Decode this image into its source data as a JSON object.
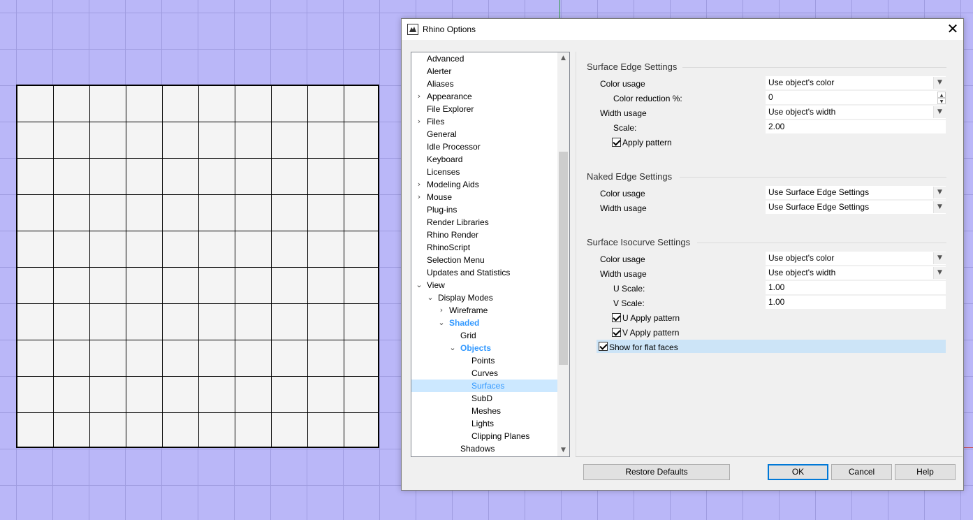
{
  "dialog": {
    "title": "Rhino Options",
    "close_glyph": "✕"
  },
  "tree": {
    "items": [
      {
        "label": "Advanced",
        "level": 0,
        "exp": ""
      },
      {
        "label": "Alerter",
        "level": 0,
        "exp": ""
      },
      {
        "label": "Aliases",
        "level": 0,
        "exp": ""
      },
      {
        "label": "Appearance",
        "level": 0,
        "exp": ">"
      },
      {
        "label": "File Explorer",
        "level": 0,
        "exp": ""
      },
      {
        "label": "Files",
        "level": 0,
        "exp": ">"
      },
      {
        "label": "General",
        "level": 0,
        "exp": ""
      },
      {
        "label": "Idle Processor",
        "level": 0,
        "exp": ""
      },
      {
        "label": "Keyboard",
        "level": 0,
        "exp": ""
      },
      {
        "label": "Licenses",
        "level": 0,
        "exp": ""
      },
      {
        "label": "Modeling Aids",
        "level": 0,
        "exp": ">"
      },
      {
        "label": "Mouse",
        "level": 0,
        "exp": ">"
      },
      {
        "label": "Plug-ins",
        "level": 0,
        "exp": ""
      },
      {
        "label": "Render Libraries",
        "level": 0,
        "exp": ""
      },
      {
        "label": "Rhino Render",
        "level": 0,
        "exp": ""
      },
      {
        "label": "RhinoScript",
        "level": 0,
        "exp": ""
      },
      {
        "label": "Selection Menu",
        "level": 0,
        "exp": ""
      },
      {
        "label": "Updates and Statistics",
        "level": 0,
        "exp": ""
      },
      {
        "label": "View",
        "level": 0,
        "exp": "v"
      },
      {
        "label": "Display Modes",
        "level": 1,
        "exp": "v"
      },
      {
        "label": "Wireframe",
        "level": 2,
        "exp": ">"
      },
      {
        "label": "Shaded",
        "level": 2,
        "exp": "v",
        "bold": true
      },
      {
        "label": "Grid",
        "level": 3,
        "exp": ""
      },
      {
        "label": "Objects",
        "level": 3,
        "exp": "v",
        "bold": true
      },
      {
        "label": "Points",
        "level": 4,
        "exp": ""
      },
      {
        "label": "Curves",
        "level": 4,
        "exp": ""
      },
      {
        "label": "Surfaces",
        "level": 4,
        "exp": "",
        "selected": true
      },
      {
        "label": "SubD",
        "level": 4,
        "exp": ""
      },
      {
        "label": "Meshes",
        "level": 4,
        "exp": ""
      },
      {
        "label": "Lights",
        "level": 4,
        "exp": ""
      },
      {
        "label": "Clipping Planes",
        "level": 4,
        "exp": ""
      },
      {
        "label": "Shadows",
        "level": 3,
        "exp": ""
      }
    ],
    "scroll_up": "▲",
    "scroll_down": "▼"
  },
  "surface_edge": {
    "title": "Surface Edge Settings",
    "color_usage_label": "Color usage",
    "color_usage_value": "Use object's color",
    "color_reduction_label": "Color reduction %:",
    "color_reduction_value": "0",
    "width_usage_label": "Width usage",
    "width_usage_value": "Use object's width",
    "scale_label": "Scale:",
    "scale_value": "2.00",
    "apply_pattern_label": "Apply pattern"
  },
  "naked_edge": {
    "title": "Naked Edge Settings",
    "color_usage_label": "Color usage",
    "color_usage_value": "Use Surface Edge Settings",
    "width_usage_label": "Width usage",
    "width_usage_value": "Use Surface Edge Settings"
  },
  "isocurve": {
    "title": "Surface Isocurve Settings",
    "color_usage_label": "Color usage",
    "color_usage_value": "Use object's color",
    "width_usage_label": "Width usage",
    "width_usage_value": "Use object's width",
    "u_scale_label": "U Scale:",
    "u_scale_value": "1.00",
    "v_scale_label": "V Scale:",
    "v_scale_value": "1.00",
    "u_apply_label": "U Apply pattern",
    "v_apply_label": "V Apply pattern",
    "flat_faces_label": "Show for flat faces"
  },
  "glyphs": {
    "combo_arrow": "▼",
    "spin_up": "▲",
    "spin_down": "▼"
  },
  "buttons": {
    "restore": "Restore Defaults",
    "ok": "OK",
    "cancel": "Cancel",
    "help": "Help"
  },
  "colors": {
    "viewport_bg": "#bab7f8",
    "selection_bg": "#cce8ff",
    "selection_text": "#3399ff",
    "default_button_border": "#0078d7"
  }
}
